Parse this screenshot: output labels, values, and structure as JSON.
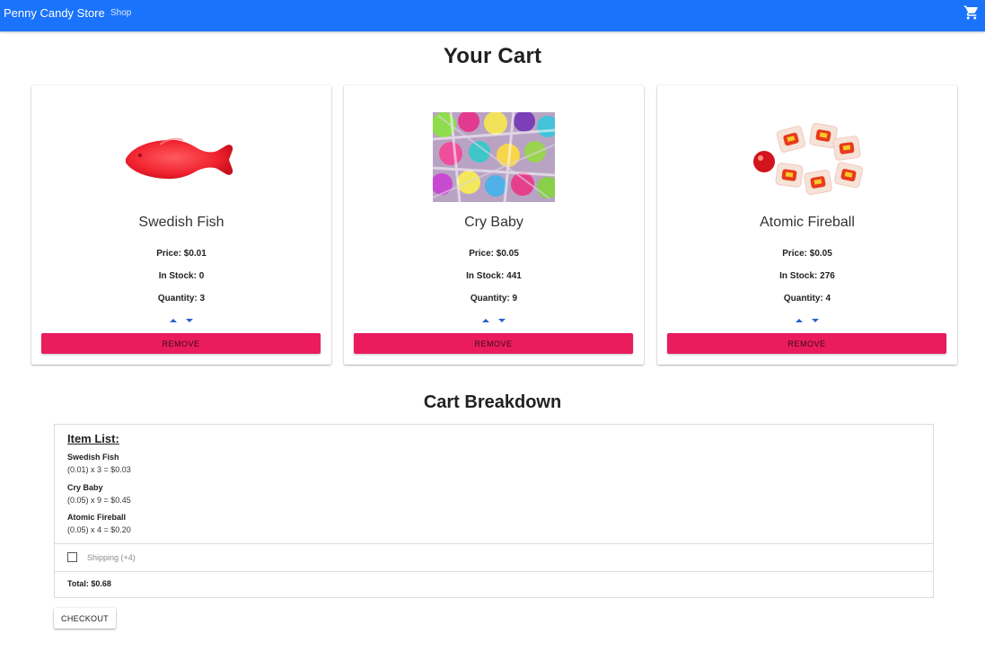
{
  "navbar": {
    "brand": "Penny Candy Store",
    "shop_link": "Shop",
    "cart_icon": "shopping-cart-icon"
  },
  "page_title": "Your Cart",
  "cart": {
    "items": [
      {
        "name": "Swedish Fish",
        "image": "swedish-fish-image",
        "price": "Price: $0.01",
        "stock": "In Stock: 0",
        "quantity": "Quantity: 3",
        "remove_label": "REMOVE"
      },
      {
        "name": "Cry Baby",
        "image": "cry-baby-candies-image",
        "price": "Price: $0.05",
        "stock": "In Stock: 441",
        "quantity": "Quantity: 9",
        "remove_label": "REMOVE"
      },
      {
        "name": "Atomic Fireball",
        "image": "atomic-fireball-image",
        "price": "Price: $0.05",
        "stock": "In Stock: 276",
        "quantity": "Quantity: 4",
        "remove_label": "REMOVE"
      }
    ]
  },
  "breakdown": {
    "title": "Cart Breakdown",
    "item_list_title": "Item List:",
    "lines": [
      {
        "name": "Swedish Fish",
        "calc": "(0.01) x 3 = $0.03"
      },
      {
        "name": "Cry Baby",
        "calc": "(0.05) x 9 = $0.45"
      },
      {
        "name": "Atomic Fireball",
        "calc": "(0.05) x 4 = $0.20"
      }
    ],
    "shipping_label": "Shipping (+4)",
    "shipping_checked": false,
    "total": "Total: $0.68"
  },
  "checkout_label": "CHECKOUT",
  "colors": {
    "navbar": "#1a73fb",
    "remove_button": "#ea1c5d"
  }
}
